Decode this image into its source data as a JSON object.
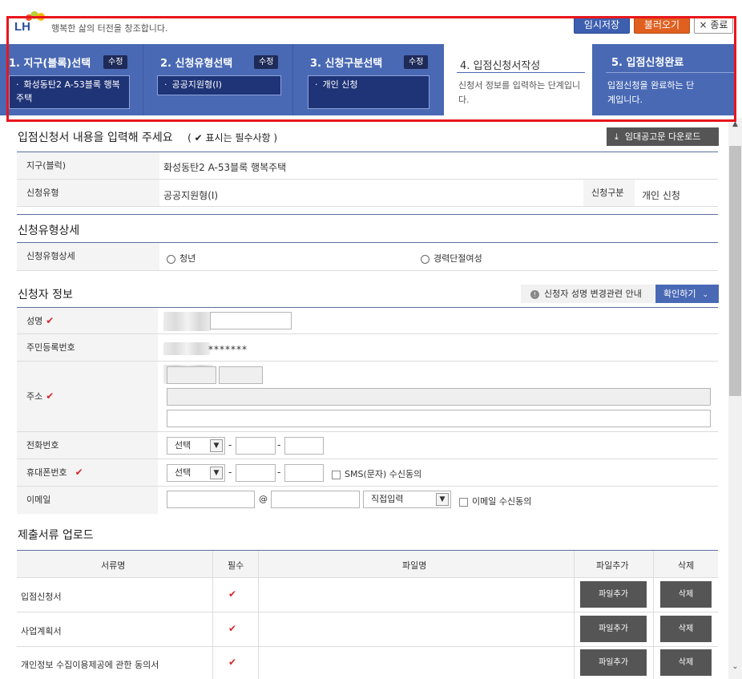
{
  "header": {
    "logo_text": "LH",
    "slogan": "행복한 삶의 터전을 창조합니다.",
    "save_temp": "임시저장",
    "load": "불러오기",
    "close": "× 종료"
  },
  "steps": [
    {
      "label": "1. 지구(블록)선택",
      "edit": "수정",
      "value": "화성동탄2 A-53블록 행복주택"
    },
    {
      "label": "2. 신청유형선택",
      "edit": "수정",
      "value": "공공지원형(Ⅰ)"
    },
    {
      "label": "3. 신청구분선택",
      "edit": "수정",
      "value": "개인 신청"
    },
    {
      "label": "4. 입점신청서작성",
      "desc": "신청서 정보를 입력하는 단계입니다."
    },
    {
      "label": "5. 입점신청완료",
      "desc": "입점신청을 완료하는 단계입니다."
    }
  ],
  "form_intro": {
    "title": "입점신청서 내용을 입력해 주세요",
    "required_note": "( ✔ 표시는 필수사항 )",
    "download_button": "임대공고문 다운로드"
  },
  "summary": {
    "district_label": "지구(블럭)",
    "district_value": "화성동탄2 A-53블록 행복주택",
    "type_label": "신청유형",
    "type_value": "공공지원형(Ⅰ)",
    "category_label": "신청구분",
    "category_value": "개인 신청"
  },
  "type_detail": {
    "title": "신청유형상세",
    "label": "신청유형상세",
    "options": [
      "청년",
      "경력단절여성"
    ]
  },
  "applicant": {
    "title": "신청자 정보",
    "notice": "신청자 성명 변경관련 안내",
    "confirm_button": "확인하기",
    "name_label": "성명",
    "rrn_label": "주민등록번호",
    "rrn_mask": "*******",
    "address_label": "주소",
    "phone_label": "전화번호",
    "phone_select": "선택",
    "mobile_label": "휴대폰번호",
    "mobile_select": "선택",
    "sms_consent": "SMS(문자) 수신동의",
    "email_label": "이메일",
    "email_at": "@",
    "email_domain_select": "직접입력",
    "email_consent": "이메일 수신동의"
  },
  "documents": {
    "title": "제출서류 업로드",
    "headers": [
      "서류명",
      "필수",
      "파일명",
      "파일추가",
      "삭제"
    ],
    "rows": [
      {
        "name": "입점신청서",
        "add": "파일추가",
        "delete": "삭제"
      },
      {
        "name": "사업계획서",
        "add": "파일추가",
        "delete": "삭제"
      },
      {
        "name": "개인정보 수집이용제공에 관한 동의서",
        "add": "파일추가",
        "delete": "삭제"
      }
    ]
  },
  "colors": {
    "accent_blue": "#4969b4",
    "highlight_red": "#e8161c",
    "load_orange": "#e06020",
    "check_red": "#d6262c"
  }
}
